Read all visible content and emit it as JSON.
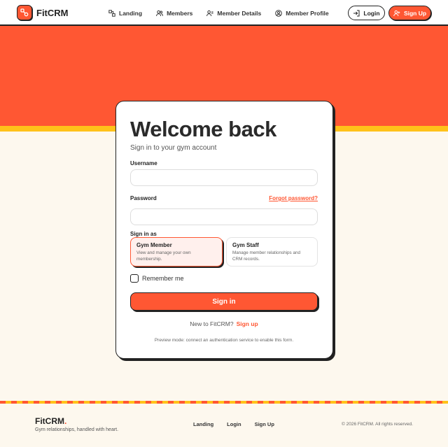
{
  "header": {
    "brand_name": "FitCRM",
    "nav": [
      {
        "label": "Landing",
        "icon": "landing-icon"
      },
      {
        "label": "Members",
        "icon": "members-icon"
      },
      {
        "label": "Member Details",
        "icon": "member-details-icon"
      },
      {
        "label": "Member Profile",
        "icon": "member-profile-icon"
      }
    ],
    "login_label": "Login",
    "signup_label": "Sign Up"
  },
  "colors": {
    "accent": "#ff5733",
    "stripe": "#ffc21a",
    "background": "#fdf8ee",
    "ink": "#222222"
  },
  "login_card": {
    "title": "Welcome back",
    "subtitle": "Sign in to your gym account",
    "username_label": "Username",
    "username_value": "",
    "password_label": "Password",
    "password_value": "",
    "forgot_label": "Forgot password?",
    "role_label": "Sign in as",
    "roles": [
      {
        "title": "Gym Member",
        "description": "View and manage your own membership.",
        "selected": true
      },
      {
        "title": "Gym Staff",
        "description": "Manage member relationships and CRM records.",
        "selected": false
      }
    ],
    "remember_label": "Remember me",
    "remember_checked": false,
    "submit_label": "Sign in",
    "new_prompt": "New to FitCRM?",
    "signup_link": "Sign up",
    "preview_note": "Preview mode: connect an authentication service to enable this form."
  },
  "footer": {
    "brand": "FitCRM",
    "brand_dot": ".",
    "tagline": "Gym relationships, handled with heart.",
    "links": [
      "Landing",
      "Login",
      "Sign Up"
    ],
    "copyright": "© 2026 FitCRM. All rights reserved."
  }
}
